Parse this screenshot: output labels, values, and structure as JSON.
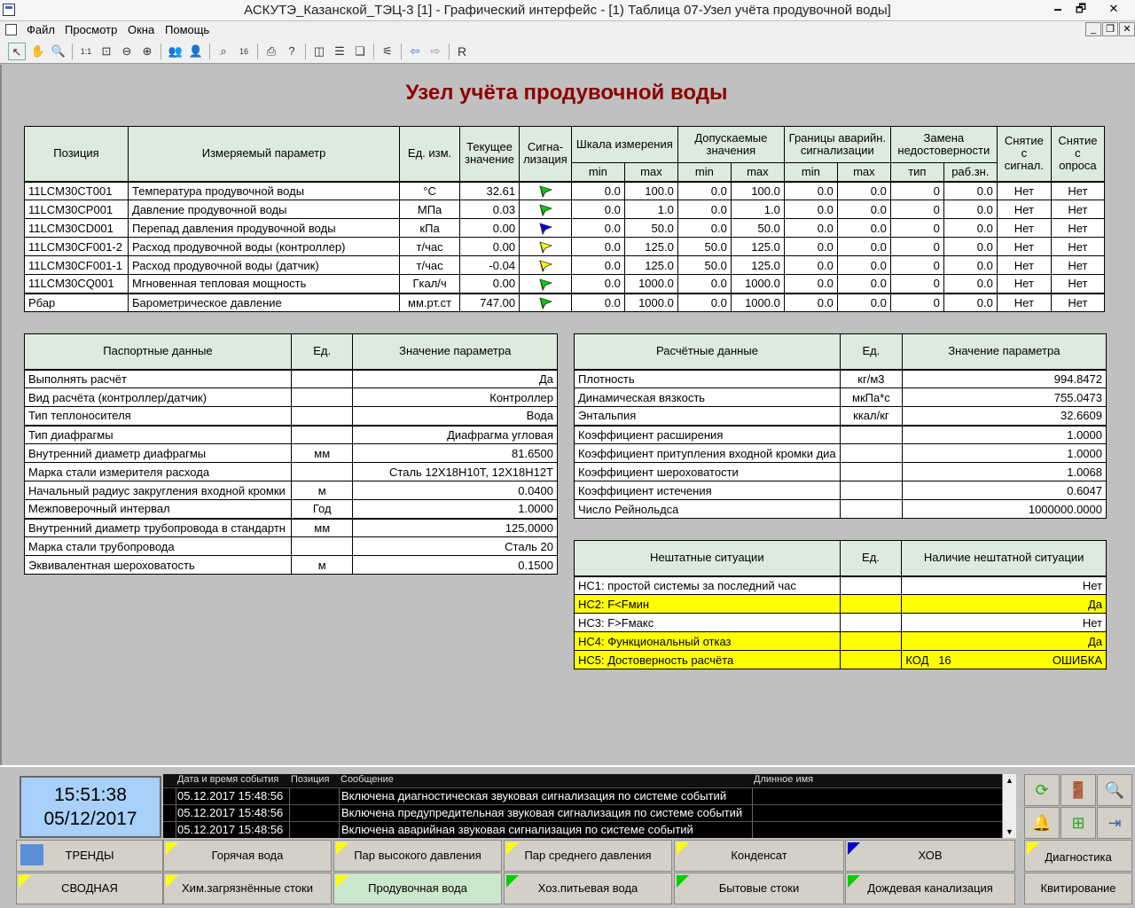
{
  "window": {
    "title": "АСКУТЭ_Казанской_ТЭЦ-3 [1] - Графический интерфейс - [1) Таблица 07-Узел учёта продувочной воды]",
    "minimize": "🗕",
    "restore": "🗗",
    "close": "✕"
  },
  "menu": [
    "Файл",
    "Просмотр",
    "Окна",
    "Помощь"
  ],
  "toolbar": {
    "r_label": "R"
  },
  "page": {
    "title": "Узел учёта продувочной воды"
  },
  "main_table": {
    "headers": {
      "position": "Позиция",
      "param": "Измеряемый параметр",
      "unit": "Ед. изм.",
      "current": "Текущее значение",
      "signal": "Сигна-лизация",
      "scale": "Шкала измерения",
      "allowed": "Допускаемые значения",
      "alarm": "Границы аварийн. сигнализации",
      "replace": "Замена недостоверности",
      "remove_signal": "Снятие с сигнал.",
      "remove_poll": "Снятие с опроса",
      "min": "min",
      "max": "max",
      "type": "тип",
      "work": "раб.зн."
    },
    "rows": [
      {
        "pos": "11LCM30CT001",
        "param": "Температура  продувочной воды",
        "unit": "°C",
        "val": "32.61",
        "flag": "green",
        "smin": "0.0",
        "smax": "100.0",
        "amin": "0.0",
        "amax": "100.0",
        "bmin": "0.0",
        "bmax": "0.0",
        "rt": "0",
        "rw": "0.0",
        "s1": "Нет",
        "s2": "Нет"
      },
      {
        "pos": "11LCM30CP001",
        "param": "Давление продувочной воды",
        "unit": "МПа",
        "val": "0.03",
        "flag": "green",
        "smin": "0.0",
        "smax": "1.0",
        "amin": "0.0",
        "amax": "1.0",
        "bmin": "0.0",
        "bmax": "0.0",
        "rt": "0",
        "rw": "0.0",
        "s1": "Нет",
        "s2": "Нет"
      },
      {
        "pos": "11LCM30CD001",
        "param": "Перепад давления продувочной воды",
        "unit": "кПа",
        "val": "0.00",
        "flag": "blue",
        "smin": "0.0",
        "smax": "50.0",
        "amin": "0.0",
        "amax": "50.0",
        "bmin": "0.0",
        "bmax": "0.0",
        "rt": "0",
        "rw": "0.0",
        "s1": "Нет",
        "s2": "Нет"
      },
      {
        "pos": "11LCM30CF001-2",
        "param": "Расход продувочной воды (контроллер)",
        "unit": "т/час",
        "val": "0.00",
        "flag": "yellow",
        "smin": "0.0",
        "smax": "125.0",
        "amin": "50.0",
        "amax": "125.0",
        "bmin": "0.0",
        "bmax": "0.0",
        "rt": "0",
        "rw": "0.0",
        "s1": "Нет",
        "s2": "Нет"
      },
      {
        "pos": "11LCM30CF001-1",
        "param": "Расход продувочной воды (датчик)",
        "unit": "т/час",
        "val": "-0.04",
        "flag": "yellow",
        "smin": "0.0",
        "smax": "125.0",
        "amin": "50.0",
        "amax": "125.0",
        "bmin": "0.0",
        "bmax": "0.0",
        "rt": "0",
        "rw": "0.0",
        "s1": "Нет",
        "s2": "Нет"
      },
      {
        "pos": "11LCM30CQ001",
        "param": "Мгновенная тепловая мощность",
        "unit": "Гкал/ч",
        "val": "0.00",
        "flag": "green",
        "smin": "0.0",
        "smax": "1000.0",
        "amin": "0.0",
        "amax": "1000.0",
        "bmin": "0.0",
        "bmax": "0.0",
        "rt": "0",
        "rw": "0.0",
        "s1": "Нет",
        "s2": "Нет"
      },
      {
        "pos": "Pбар",
        "param": "Барометрическое давление",
        "unit": "мм.рт.ст",
        "val": "747.00",
        "flag": "green",
        "smin": "0.0",
        "smax": "1000.0",
        "amin": "0.0",
        "amax": "1000.0",
        "bmin": "0.0",
        "bmax": "0.0",
        "rt": "0",
        "rw": "0.0",
        "s1": "Нет",
        "s2": "Нет"
      }
    ]
  },
  "passport": {
    "headers": {
      "name": "Паспортные данные",
      "unit": "Ед.",
      "value": "Значение параметра"
    },
    "rows": [
      {
        "name": "Выполнять расчёт",
        "unit": "",
        "value": "Да"
      },
      {
        "name": "Вид расчёта (контроллер/датчик)",
        "unit": "",
        "value": "Контроллер"
      },
      {
        "name": "Тип теплоносителя",
        "unit": "",
        "value": "Вода"
      },
      {
        "name": "Тип диафрагмы",
        "unit": "",
        "value": "Диафрагма угловая"
      },
      {
        "name": "Внутренний диаметр диафрагмы",
        "unit": "мм",
        "value": "81.6500"
      },
      {
        "name": "Марка стали измерителя расхода",
        "unit": "",
        "value": "Сталь 12Х18Н10Т, 12Х18Н12Т"
      },
      {
        "name": "Начальный радиус закругления входной кромки",
        "unit": "м",
        "value": "0.0400"
      },
      {
        "name": "Межповерочный интервал",
        "unit": "Год",
        "value": "1.0000"
      },
      {
        "name": "Внутренний диаметр трубопровода в стандартн",
        "unit": "мм",
        "value": "125.0000"
      },
      {
        "name": "Марка стали трубопровода",
        "unit": "",
        "value": "Сталь 20"
      },
      {
        "name": "Эквивалентная шероховатость",
        "unit": "м",
        "value": "0.1500"
      }
    ]
  },
  "calc": {
    "headers": {
      "name": "Расчётные данные",
      "unit": "Ед.",
      "value": "Значение параметра"
    },
    "rows": [
      {
        "name": "Плотность",
        "unit": "кг/м3",
        "value": "994.8472"
      },
      {
        "name": "Динамическая вязкость",
        "unit": "мкПа*с",
        "value": "755.0473"
      },
      {
        "name": "Энтальпия",
        "unit": "ккал/кг",
        "value": "32.6609"
      },
      {
        "name": "Коэффициент расширения",
        "unit": "",
        "value": "1.0000"
      },
      {
        "name": "Коэффициент притупления входной кромки диа",
        "unit": "",
        "value": "1.0000"
      },
      {
        "name": "Коэффициент шероховатости",
        "unit": "",
        "value": "1.0068"
      },
      {
        "name": "Коэффициент истечения",
        "unit": "",
        "value": "0.6047"
      },
      {
        "name": "Число Рейнольдса",
        "unit": "",
        "value": "1000000.0000"
      }
    ]
  },
  "abnormal": {
    "headers": {
      "name": "Нештатные ситуации",
      "unit": "Ед.",
      "value": "Наличие нештатной ситуации"
    },
    "rows": [
      {
        "name": "НС1: простой системы за последний час",
        "unit": "",
        "code": "",
        "value": "Нет",
        "yellow": false
      },
      {
        "name": "НС2: F<Fмин",
        "unit": "",
        "code": "",
        "value": "Да",
        "yellow": true
      },
      {
        "name": "НС3: F>Fмакс",
        "unit": "",
        "code": "",
        "value": "Нет",
        "yellow": false
      },
      {
        "name": "НС4: Функциональный отказ",
        "unit": "",
        "code": "",
        "value": "Да",
        "yellow": true
      },
      {
        "name": "НС5: Достоверность расчёта",
        "unit": "",
        "code": "КОД   16",
        "value": "ОШИБКА",
        "yellow": true
      }
    ]
  },
  "clock": {
    "time": "15:51:38",
    "date": "05/12/2017"
  },
  "events": {
    "headers": {
      "datetime": "Дата и время события",
      "position": "Позиция",
      "message": "Сообщение",
      "longname": "Длинное имя"
    },
    "rows": [
      {
        "datetime": "05.12.2017 15:48:56",
        "position": "",
        "message": "Включена диагностическая звуковая сигнализация по системе событий"
      },
      {
        "datetime": "05.12.2017 15:48:56",
        "position": "",
        "message": "Включена предупредительная звуковая сигнализация по системе событий"
      },
      {
        "datetime": "05.12.2017 15:48:56",
        "position": "",
        "message": "Включена аварийная звуковая сигнализация по системе событий"
      }
    ]
  },
  "nav": {
    "trends": "ТРЕНДЫ",
    "summary": "СВОДНАЯ",
    "hot_water": "Горячая вода",
    "hp_steam": "Пар высокого давления",
    "mp_steam": "Пар среднего давления",
    "condensate": "Конденсат",
    "hov": "ХОВ",
    "diagnostics": "Диагностика",
    "chem_drain": "Хим.загрязнённые стоки",
    "blowdown": "Продувочная вода",
    "drinking": "Хоз.питьевая вода",
    "household": "Бытовые стоки",
    "rain": "Дождевая канализация",
    "ack": "Квитирование"
  }
}
